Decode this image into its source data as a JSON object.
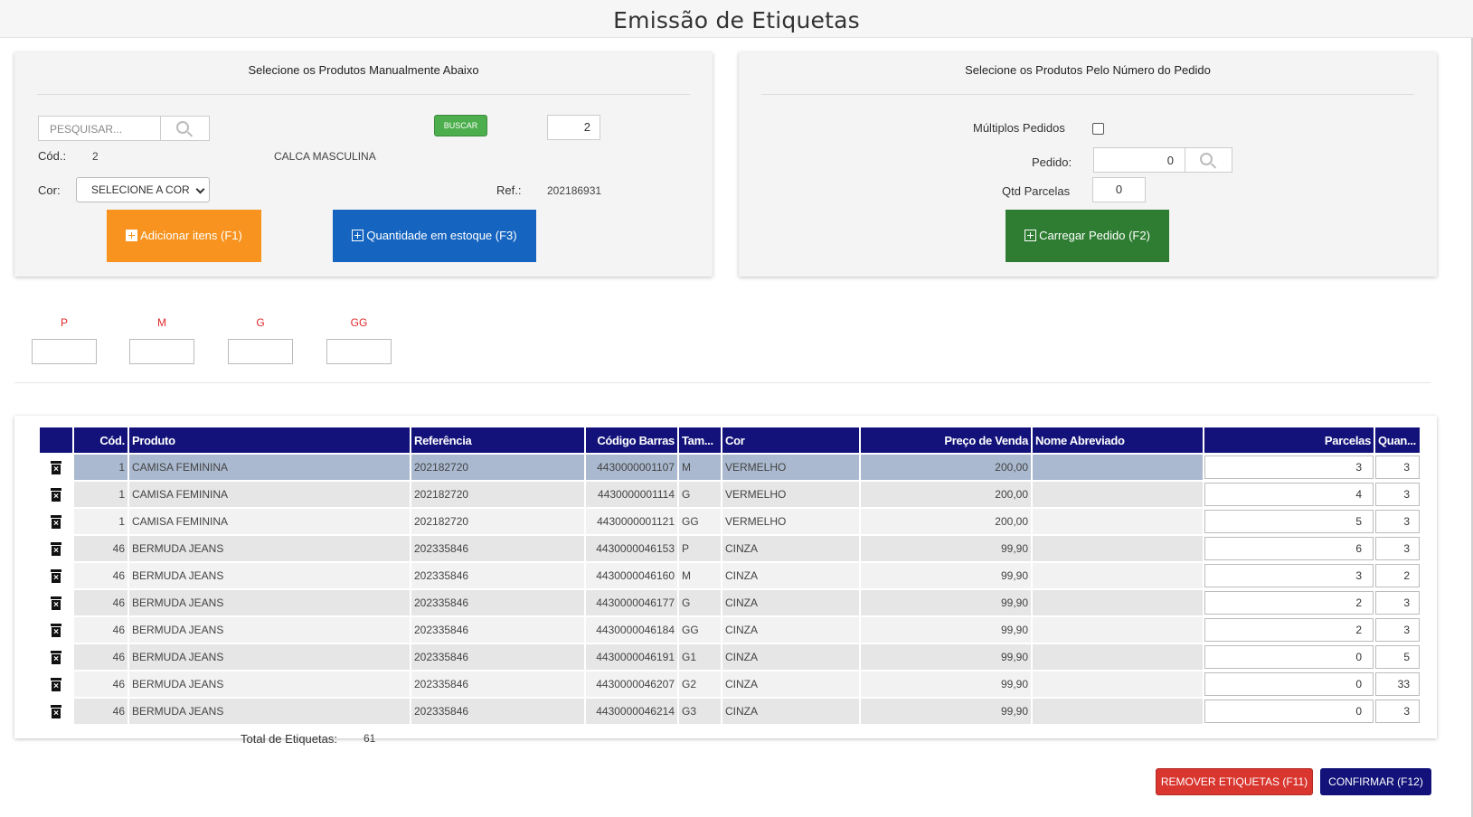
{
  "page": {
    "title": "Emissão de Etiquetas"
  },
  "manual": {
    "title": "Selecione os Produtos Manualmente Abaixo",
    "search_placeholder": "PESQUISAR...",
    "buscar_label": "BUSCAR",
    "quantity_value": "2",
    "cod_label": "Cód.:",
    "cod_value": "2",
    "product_name": "CALCA MASCULINA",
    "cor_label": "Cor:",
    "cor_select_value": "SELECIONE A COR",
    "ref_label": "Ref.:",
    "ref_value": "202186931",
    "add_button": "Adicionar itens (F1)",
    "stock_button": "Quantidade em estoque (F3)"
  },
  "pedido": {
    "title": "Selecione os Produtos Pelo Número do Pedido",
    "multiplos_label": "Múltiplos Pedidos",
    "multiplos_checked": false,
    "pedido_label": "Pedido:",
    "pedido_value": "0",
    "parcelas_label": "Qtd Parcelas",
    "parcelas_value": "0",
    "load_button": "Carregar Pedido (F2)"
  },
  "sizes": [
    "P",
    "M",
    "G",
    "GG"
  ],
  "colors": {
    "header_bg": "#12127a",
    "orange": "#f7931e",
    "blue": "#1565c0",
    "green": "#2e7d32",
    "buscar_green": "#4cae4c",
    "size_label_red": "#e0282a",
    "remove_red": "#d9362f",
    "selected_row": "#aab9cf"
  },
  "table": {
    "columns": [
      "Cód.",
      "Produto",
      "Referência",
      "Código Barras",
      "Tam...",
      "Cor",
      "Preço de Venda",
      "Nome Abreviado",
      "Parcelas",
      "Quan..."
    ],
    "rows": [
      {
        "cod": "1",
        "produto": "CAMISA FEMININA",
        "referencia": "202182720",
        "codigo_barras": "4430000001107",
        "tamanho": "M",
        "cor": "VERMELHO",
        "preco": "200,00",
        "nome_abreviado": "",
        "parcelas": "3",
        "quantidade": "3",
        "selected": true
      },
      {
        "cod": "1",
        "produto": "CAMISA FEMININA",
        "referencia": "202182720",
        "codigo_barras": "4430000001114",
        "tamanho": "G",
        "cor": "VERMELHO",
        "preco": "200,00",
        "nome_abreviado": "",
        "parcelas": "4",
        "quantidade": "3"
      },
      {
        "cod": "1",
        "produto": "CAMISA FEMININA",
        "referencia": "202182720",
        "codigo_barras": "4430000001121",
        "tamanho": "GG",
        "cor": "VERMELHO",
        "preco": "200,00",
        "nome_abreviado": "",
        "parcelas": "5",
        "quantidade": "3"
      },
      {
        "cod": "46",
        "produto": "BERMUDA JEANS",
        "referencia": "202335846",
        "codigo_barras": "4430000046153",
        "tamanho": "P",
        "cor": "CINZA",
        "preco": "99,90",
        "nome_abreviado": "",
        "parcelas": "6",
        "quantidade": "3"
      },
      {
        "cod": "46",
        "produto": "BERMUDA JEANS",
        "referencia": "202335846",
        "codigo_barras": "4430000046160",
        "tamanho": "M",
        "cor": "CINZA",
        "preco": "99,90",
        "nome_abreviado": "",
        "parcelas": "3",
        "quantidade": "2"
      },
      {
        "cod": "46",
        "produto": "BERMUDA JEANS",
        "referencia": "202335846",
        "codigo_barras": "4430000046177",
        "tamanho": "G",
        "cor": "CINZA",
        "preco": "99,90",
        "nome_abreviado": "",
        "parcelas": "2",
        "quantidade": "3"
      },
      {
        "cod": "46",
        "produto": "BERMUDA JEANS",
        "referencia": "202335846",
        "codigo_barras": "4430000046184",
        "tamanho": "GG",
        "cor": "CINZA",
        "preco": "99,90",
        "nome_abreviado": "",
        "parcelas": "2",
        "quantidade": "3"
      },
      {
        "cod": "46",
        "produto": "BERMUDA JEANS",
        "referencia": "202335846",
        "codigo_barras": "4430000046191",
        "tamanho": "G1",
        "cor": "CINZA",
        "preco": "99,90",
        "nome_abreviado": "",
        "parcelas": "0",
        "quantidade": "5"
      },
      {
        "cod": "46",
        "produto": "BERMUDA JEANS",
        "referencia": "202335846",
        "codigo_barras": "4430000046207",
        "tamanho": "G2",
        "cor": "CINZA",
        "preco": "99,90",
        "nome_abreviado": "",
        "parcelas": "0",
        "quantidade": "33"
      },
      {
        "cod": "46",
        "produto": "BERMUDA JEANS",
        "referencia": "202335846",
        "codigo_barras": "4430000046214",
        "tamanho": "G3",
        "cor": "CINZA",
        "preco": "99,90",
        "nome_abreviado": "",
        "parcelas": "0",
        "quantidade": "3"
      }
    ]
  },
  "footer": {
    "total_label": "Total de Etiquetas:",
    "total_value": "61",
    "remove_button": "REMOVER ETIQUETAS (F11)",
    "confirm_button": "CONFIRMAR (F12)"
  }
}
